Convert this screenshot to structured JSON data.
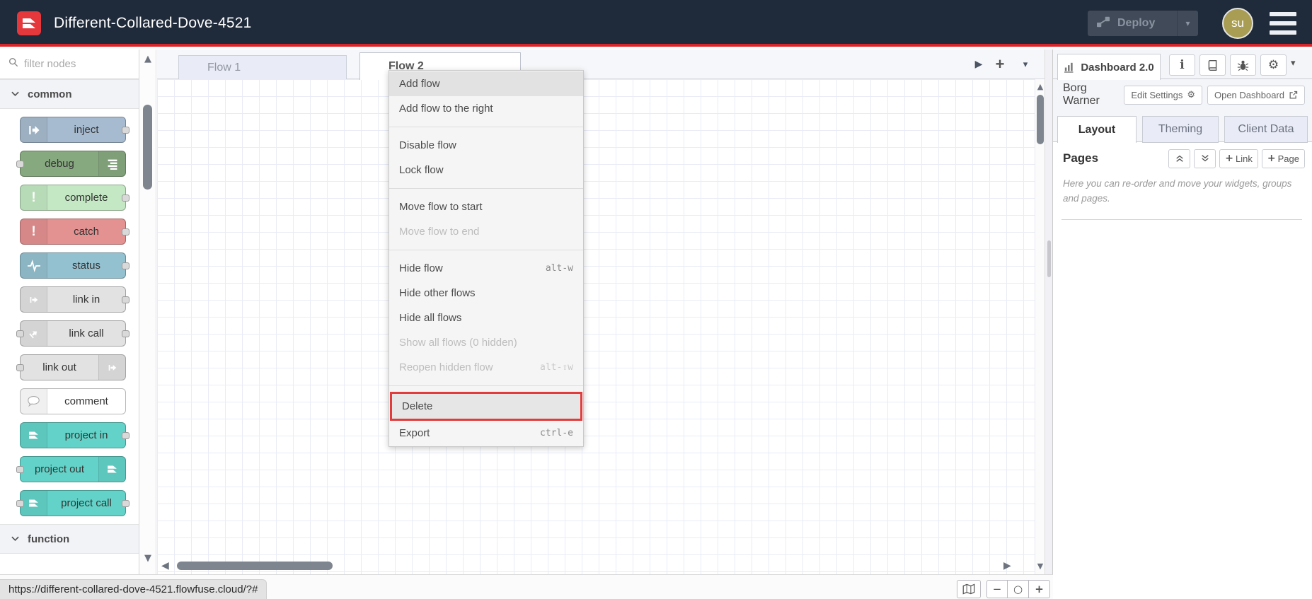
{
  "header": {
    "title": "Different-Collared-Dove-4521",
    "deploy_label": "Deploy",
    "avatar_text": "su"
  },
  "palette": {
    "filter_placeholder": "filter nodes",
    "categories": [
      {
        "label": "common"
      },
      {
        "label": "function"
      }
    ],
    "nodes": [
      {
        "name": "inject",
        "label": "inject",
        "color": "#a6bbcf",
        "icon": "arrow-in-icon",
        "icon_side": "left",
        "ports": [
          "right"
        ]
      },
      {
        "name": "debug",
        "label": "debug",
        "color": "#87a980",
        "icon": "debug-list-icon",
        "icon_side": "right",
        "ports": [
          "left"
        ]
      },
      {
        "name": "complete",
        "label": "complete",
        "color": "#c3e8c3",
        "icon": "exclamation-icon",
        "icon_side": "left",
        "ports": [
          "right"
        ]
      },
      {
        "name": "catch",
        "label": "catch",
        "color": "#e49191",
        "icon": "exclamation-icon",
        "icon_side": "left",
        "ports": [
          "right"
        ]
      },
      {
        "name": "status",
        "label": "status",
        "color": "#94c1d0",
        "icon": "status-pulse-icon",
        "icon_side": "left",
        "ports": [
          "right"
        ]
      },
      {
        "name": "link-in",
        "label": "link in",
        "color": "#e2e2e2",
        "icon": "link-arrow-icon",
        "icon_side": "left",
        "ports": [
          "right"
        ]
      },
      {
        "name": "link-call",
        "label": "link call",
        "color": "#e2e2e2",
        "icon": "link-call-icon",
        "icon_side": "left",
        "ports": [
          "left",
          "right"
        ]
      },
      {
        "name": "link-out",
        "label": "link out",
        "color": "#e2e2e2",
        "icon": "link-arrow-icon",
        "icon_side": "right",
        "ports": [
          "left"
        ]
      },
      {
        "name": "comment",
        "label": "comment",
        "color": "#ffffff",
        "icon": "comment-bubble-icon",
        "icon_side": "left",
        "ports": []
      },
      {
        "name": "project-in",
        "label": "project in",
        "color": "#63d3c9",
        "icon": "node-red-icon",
        "icon_side": "left",
        "ports": [
          "right"
        ]
      },
      {
        "name": "project-out",
        "label": "project out",
        "color": "#63d3c9",
        "icon": "node-red-icon",
        "icon_side": "right",
        "ports": [
          "left"
        ]
      },
      {
        "name": "project-call",
        "label": "project call",
        "color": "#63d3c9",
        "icon": "node-red-icon",
        "icon_side": "left",
        "ports": [
          "left",
          "right"
        ]
      }
    ]
  },
  "tabs": {
    "items": [
      {
        "label": "Flow 1",
        "active": false
      },
      {
        "label": "Flow 2",
        "active": true
      }
    ]
  },
  "context_menu": {
    "items": [
      {
        "label": "Add flow",
        "state": "hover"
      },
      {
        "label": "Add flow to the right",
        "sep_after": true
      },
      {
        "label": "Disable flow"
      },
      {
        "label": "Lock flow",
        "sep_after": true
      },
      {
        "label": "Move flow to start"
      },
      {
        "label": "Move flow to end",
        "disabled": true,
        "sep_after": true
      },
      {
        "label": "Hide flow",
        "shortcut": "alt-w"
      },
      {
        "label": "Hide other flows"
      },
      {
        "label": "Hide all flows"
      },
      {
        "label": "Show all flows (0 hidden)",
        "disabled": true
      },
      {
        "label": "Reopen hidden flow",
        "shortcut": "alt-⇧w",
        "disabled": true,
        "sep_after": true
      },
      {
        "label": "Delete",
        "state": "highlighted"
      },
      {
        "label": "Export",
        "shortcut": "ctrl-e"
      }
    ]
  },
  "sidebar": {
    "panel_tab_label": "Dashboard 2.0",
    "instance_name": "Borg Warner",
    "edit_settings_label": "Edit Settings",
    "open_dashboard_label": "Open Dashboard",
    "tabs": [
      {
        "label": "Layout",
        "active": true
      },
      {
        "label": "Theming",
        "active": false
      },
      {
        "label": "Client Data",
        "active": false
      }
    ],
    "pages_title": "Pages",
    "link_button_label": "Link",
    "page_button_label": "Page",
    "help_text": "Here you can re-order and move your widgets, groups and pages."
  },
  "footer": {
    "status_url": "https://different-collared-dove-4521.flowfuse.cloud/?#"
  },
  "icons": {
    "plus": "+",
    "minus": "−",
    "zoom_reset": "○",
    "caret_down": "▾",
    "tri_up": "▲",
    "tri_down": "▼",
    "tri_left": "◀",
    "tri_right": "▶",
    "gear": "⚙"
  },
  "colors": {
    "header_bg": "#1f2a3a",
    "accent_red": "#d8252a",
    "logo_red": "#e5383d",
    "avatar_bg": "#a89d52",
    "highlight_red": "#e23b3b",
    "grid_line": "#e9ecf6",
    "inactive_tab_bg": "#e9ecf7",
    "sidebar_bg": "#f4f5f9"
  }
}
